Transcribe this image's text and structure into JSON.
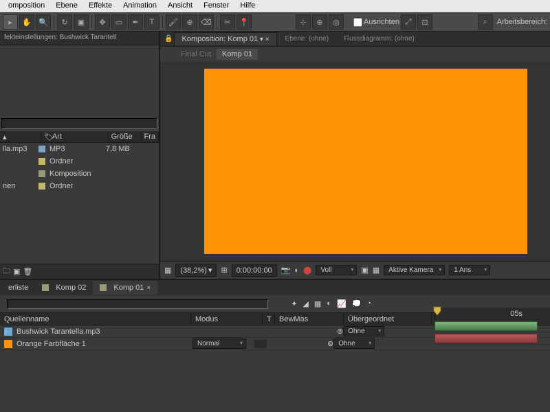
{
  "menu": [
    "omposition",
    "Ebene",
    "Effekte",
    "Animation",
    "Ansicht",
    "Fenster",
    "Hilfe"
  ],
  "toolbar_right": {
    "align": "Ausrichten",
    "workspace": "Arbeitsbereich:"
  },
  "effects_panel": {
    "title": "fekteinstellungen: Bushwick Tarantell"
  },
  "project": {
    "headers": {
      "type": "Art",
      "size": "Größe",
      "fr": "Fra"
    },
    "rows": [
      {
        "name": "lla.mp3",
        "type": "MP3",
        "size": "7,8 MB",
        "color": "#7aa6c2"
      },
      {
        "name": "",
        "type": "Ordner",
        "size": "",
        "color": "#c2b86a"
      },
      {
        "name": "",
        "type": "Komposition",
        "size": "",
        "color": "#9a9a7a"
      },
      {
        "name": "nen",
        "type": "Ordner",
        "size": "",
        "color": "#c2b86a"
      }
    ]
  },
  "comp_tabs": {
    "main": "Komposition: Komp 01",
    "layer": "Ebene: (ohne)",
    "flow": "Flussdiagramm: (ohne)"
  },
  "breadcrumb": {
    "prev": "Final Cut",
    "curr": "Komp 01"
  },
  "viewer": {
    "zoom": "(38,2%)",
    "time": "0:00:00:00",
    "res": "Voll",
    "camera": "Aktive Kamera",
    "views": "1 Ans"
  },
  "timeline": {
    "tabs": [
      "erliste",
      "Komp 02",
      "Komp 01"
    ],
    "active_tab": 2,
    "headers": {
      "source": "Quellenname",
      "mode": "Modus",
      "t": "T",
      "bewmas": "BewMas",
      "parent": "Übergeordnet"
    },
    "layers": [
      {
        "name": "Bushwick Tarantella.mp3",
        "mode": "",
        "parent": "Ohne",
        "color": "#6aa8d4",
        "icon": "audio"
      },
      {
        "name": "Orange Farbfläche 1",
        "mode": "Normal",
        "parent": "Ohne",
        "color": "#ff9408",
        "icon": "solid"
      }
    ],
    "ruler_mark": "05s"
  }
}
